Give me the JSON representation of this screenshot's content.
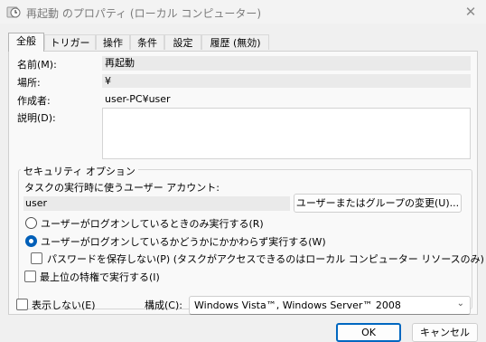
{
  "window": {
    "title": "再起動 のプロパティ (ローカル コンピューター)",
    "close_glyph": "✕"
  },
  "tabs": [
    {
      "label": "全般",
      "active": true
    },
    {
      "label": "トリガー"
    },
    {
      "label": "操作"
    },
    {
      "label": "条件"
    },
    {
      "label": "設定"
    },
    {
      "label": "履歴 (無効)"
    }
  ],
  "general": {
    "name_label": "名前(M):",
    "name_value": "再起動",
    "location_label": "場所:",
    "location_value": "¥",
    "author_label": "作成者:",
    "author_value": "user-PC¥user",
    "description_label": "説明(D):",
    "description_value": ""
  },
  "security": {
    "group_title": "セキュリティ オプション",
    "account_prompt": "タスクの実行時に使うユーザー アカウント:",
    "account_value": "user",
    "change_button": "ユーザーまたはグループの変更(U)...",
    "radio_logged_on_only": "ユーザーがログオンしているときのみ実行する(R)",
    "radio_whether_logged_on": "ユーザーがログオンしているかどうかにかかわらず実行する(W)",
    "selected_radio": "whether_logged_on",
    "no_store_password": "パスワードを保存しない(P) (タスクがアクセスできるのはローカル コンピューター リソースのみ)",
    "highest_privileges": "最上位の特権で実行する(I)"
  },
  "footer": {
    "hidden_label": "表示しない(E)",
    "configure_label": "構成(C):",
    "configure_value": "Windows Vista™, Windows Server™ 2008",
    "ok_button": "OK",
    "cancel_button": "キャンセル"
  },
  "colors": {
    "accent": "#005fb8",
    "default_button_border": "#0067c0"
  }
}
